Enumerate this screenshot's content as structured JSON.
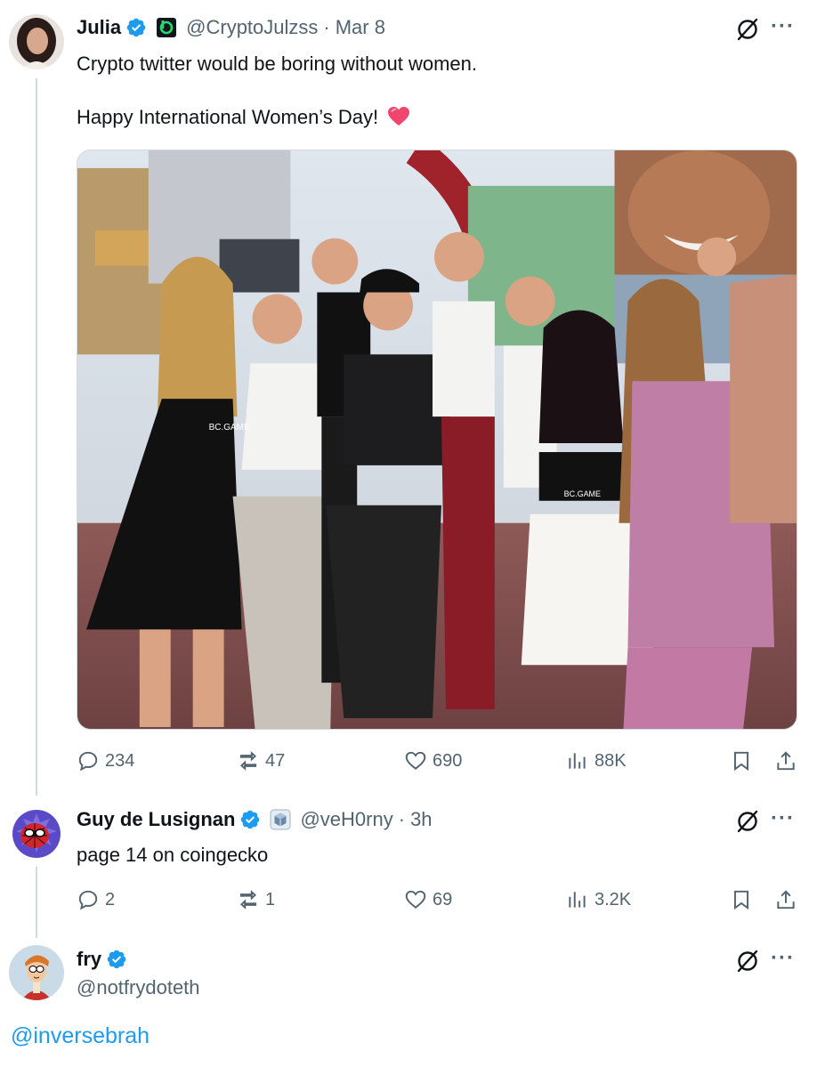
{
  "colors": {
    "verified": "#1d9bf0",
    "link": "#1d9bf0",
    "secondary": "#536471",
    "heart": "#f0466e"
  },
  "tweets": [
    {
      "name": "Julia",
      "handle": "@CryptoJulzss",
      "separator": "·",
      "time": "Mar 8",
      "text_line1": "Crypto twitter would be boring without women.",
      "text_line2": "Happy International Women’s Day!",
      "emoji": "pink-heart",
      "affiliate_icon": "bc-game-logo",
      "photo_labels": {
        "dress_logo": "BC.GAME",
        "top_logo": "BC.GAME"
      },
      "stats": {
        "replies": "234",
        "reposts": "47",
        "likes": "690",
        "views": "88K"
      }
    },
    {
      "name": "Guy de Lusignan",
      "handle": "@veH0rny",
      "separator": "·",
      "time": "3h",
      "text": "page 14 on coingecko",
      "affiliate_icon": "cube-logo",
      "stats": {
        "replies": "2",
        "reposts": "1",
        "likes": "69",
        "views": "3.2K"
      }
    },
    {
      "name": "fry",
      "handle": "@notfrydoteth",
      "mention": "@inversebrah"
    }
  ]
}
